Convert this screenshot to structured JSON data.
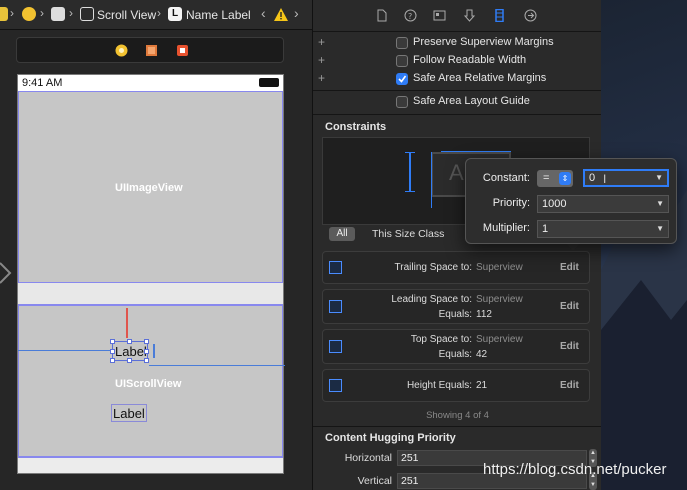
{
  "jumpbar": {
    "items": [
      "Scroll View",
      "Name Label"
    ],
    "label_icon_letter": "L"
  },
  "device": {
    "time": "9:41 AM",
    "imageview_placeholder": "UIImageView",
    "scrollview_placeholder": "UIScrollView",
    "label_selected": "Label",
    "label_other": "Label"
  },
  "inspector": {
    "checkboxes": [
      {
        "label": "Preserve Superview Margins",
        "checked": false
      },
      {
        "label": "Follow Readable Width",
        "checked": false
      },
      {
        "label": "Safe Area Relative Margins",
        "checked": true
      }
    ],
    "layout_guide": {
      "label": "Safe Area Layout Guide",
      "checked": false
    },
    "constraints_title": "Constraints",
    "preview_letter": "A",
    "segment": {
      "all": "All",
      "size_class": "This Size Class"
    },
    "constraints": [
      {
        "title": "Trailing Space to:",
        "target": "Superview",
        "equals_label": "",
        "equals_value": "",
        "edit": "Edit"
      },
      {
        "title": "Leading Space to:",
        "target": "Superview",
        "equals_label": "Equals:",
        "equals_value": "112",
        "edit": "Edit"
      },
      {
        "title": "Top Space to:",
        "target": "Superview",
        "equals_label": "Equals:",
        "equals_value": "42",
        "edit": "Edit"
      },
      {
        "title": "Height Equals:",
        "target": "21",
        "equals_label": "",
        "equals_value": "",
        "edit": "Edit"
      }
    ],
    "showing": "Showing 4 of 4",
    "hugging_title": "Content Hugging Priority",
    "hugging": [
      {
        "label": "Horizontal",
        "value": "251"
      },
      {
        "label": "Vertical",
        "value": "251"
      }
    ]
  },
  "popover": {
    "constant_label": "Constant:",
    "relation": "=",
    "constant_value": "0",
    "priority_label": "Priority:",
    "priority_value": "1000",
    "multiplier_label": "Multiplier:",
    "multiplier_value": "1"
  },
  "watermark": "https://blog.csdn.net/pucker",
  "colors": {
    "accent": "#2f7cf6",
    "selection": "#8888ee",
    "constraint": "#e0554d"
  }
}
